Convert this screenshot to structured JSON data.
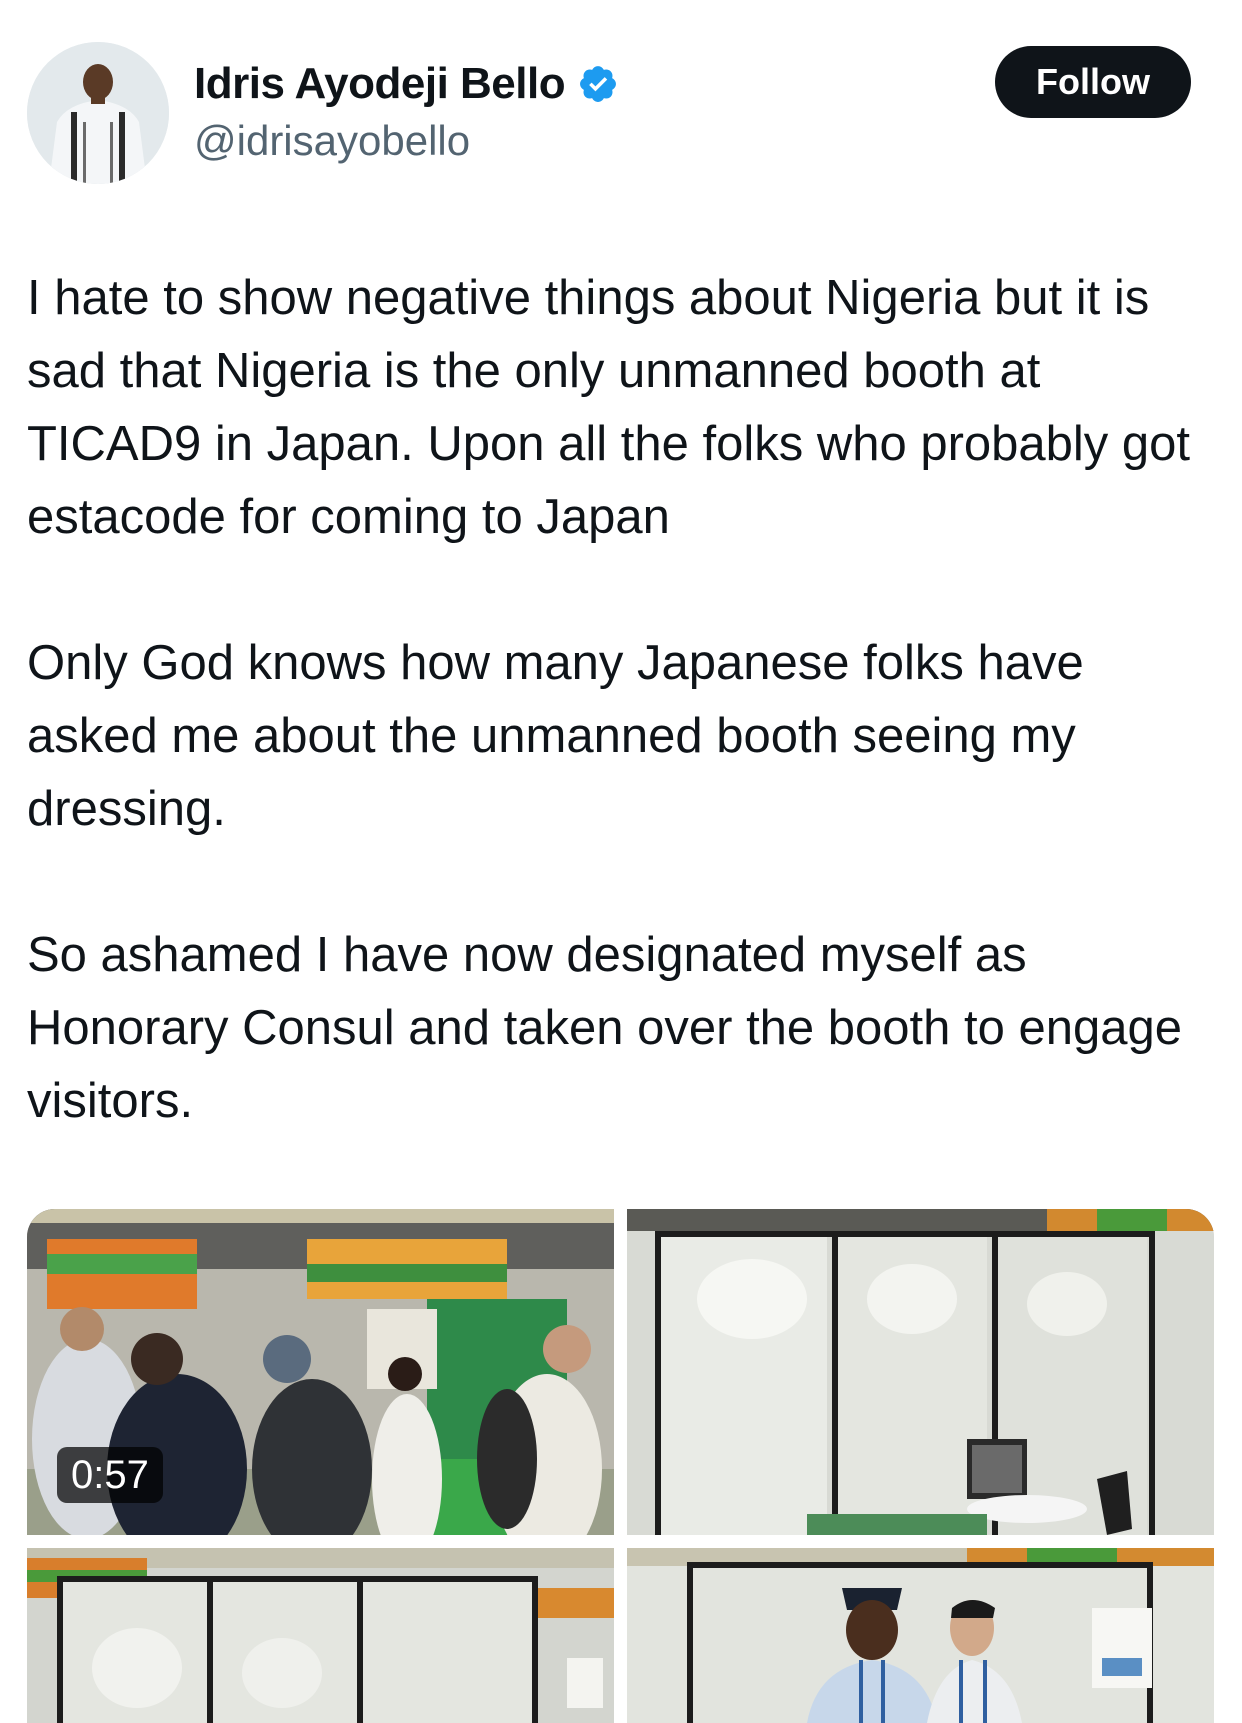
{
  "author": {
    "display_name": "Idris Ayodeji Bello",
    "handle": "@idrisayobello",
    "verified": true,
    "verified_icon": "verified-badge-icon",
    "verified_color": "#1d9bf0"
  },
  "follow_button": {
    "label": "Follow",
    "background": "#0f1419"
  },
  "tweet": {
    "paragraphs": [
      "I hate to show negative things about Nigeria but it is sad that Nigeria is the only unmanned booth at TICAD9 in Japan. Upon all the folks who probably got estacode for coming to Japan",
      "Only God knows how many Japanese folks have asked me about the unmanned booth seeing my dressing.",
      "So ashamed I have now designated myself as Honorary Consul and taken over the booth to engage visitors."
    ]
  },
  "media": {
    "video_duration": "0:57",
    "items": [
      {
        "kind": "video",
        "subject": "crowded expo hall with booths"
      },
      {
        "kind": "photo",
        "subject": "empty white booth with chair and table"
      },
      {
        "kind": "photo",
        "subject": "empty booth frame"
      },
      {
        "kind": "photo",
        "subject": "two men standing in booth"
      }
    ]
  }
}
